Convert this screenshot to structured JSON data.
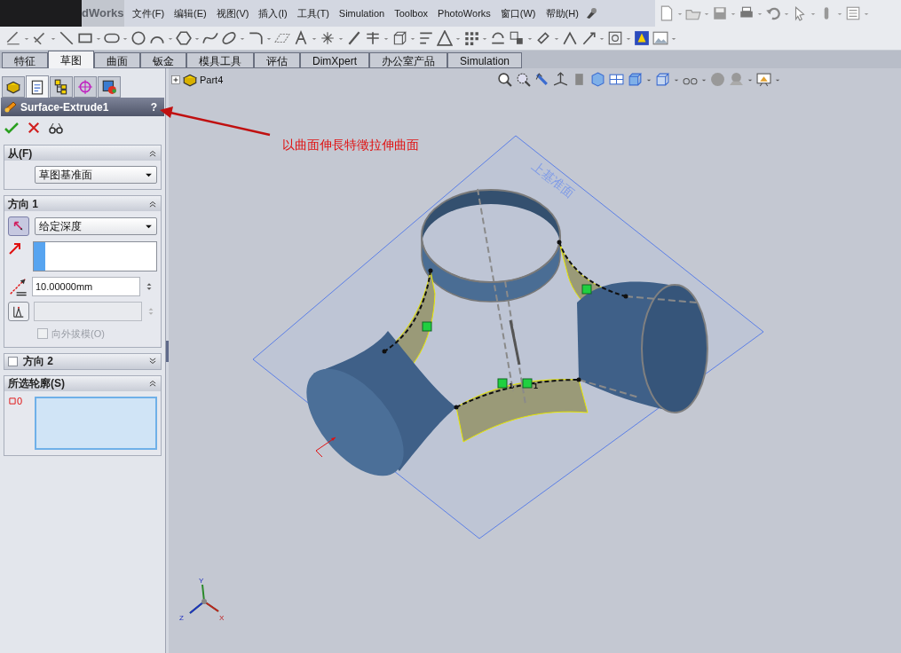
{
  "app_title": "dWorks",
  "menu": [
    "文件(F)",
    "编辑(E)",
    "视图(V)",
    "插入(I)",
    "工具(T)",
    "Simulation",
    "Toolbox",
    "PhotoWorks",
    "窗口(W)",
    "帮助(H)"
  ],
  "tabs": [
    {
      "label": "特征",
      "selected": false
    },
    {
      "label": "草图",
      "selected": true
    },
    {
      "label": "曲面",
      "selected": false
    },
    {
      "label": "钣金",
      "selected": false
    },
    {
      "label": "模具工具",
      "selected": false
    },
    {
      "label": "评估",
      "selected": false
    },
    {
      "label": "DimXpert",
      "selected": false
    },
    {
      "label": "办公室产品",
      "selected": false
    },
    {
      "label": "Simulation",
      "selected": false
    }
  ],
  "panel_tabs": [
    {
      "selected": false
    },
    {
      "selected": true
    },
    {
      "selected": false
    },
    {
      "selected": false
    },
    {
      "selected": false
    }
  ],
  "property_manager": {
    "title": "Surface-Extrude1",
    "help": "?",
    "from": {
      "title": "从(F)",
      "expanded": true,
      "value": "草图基准面"
    },
    "direction1": {
      "title": "方向 1",
      "expanded": true,
      "end_condition": "给定深度",
      "depth": "10.00000mm",
      "draft_outward": {
        "label": "向外拔模(O)",
        "checked": false,
        "disabled": true
      }
    },
    "direction2": {
      "title": "方向 2",
      "checked": false,
      "expanded": false
    },
    "profiles": {
      "title": "所选轮廓(S)",
      "expanded": true,
      "count": "0"
    }
  },
  "tree": {
    "root": "Part4",
    "expanded": false
  },
  "annotation": "以曲面伸長特徵拉伸曲面",
  "plane_label": "上基准面",
  "face_tags": [
    "1",
    "1"
  ],
  "triad": [
    "Y",
    "Z",
    "X"
  ]
}
